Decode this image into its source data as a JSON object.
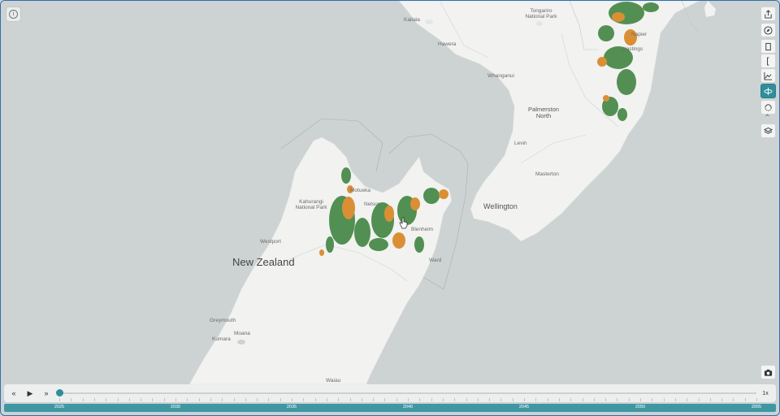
{
  "map": {
    "places": [
      {
        "id": "kaitaia",
        "name": "Kaitaia"
      },
      {
        "id": "tongariro",
        "name": "Tongariro National Park"
      },
      {
        "id": "hawera",
        "name": "Hawera"
      },
      {
        "id": "napier",
        "name": "Napier"
      },
      {
        "id": "hastings",
        "name": "Hastings"
      },
      {
        "id": "whanganui",
        "name": "Whanganui"
      },
      {
        "id": "palmerston",
        "name": "Palmerston North"
      },
      {
        "id": "levin",
        "name": "Levin"
      },
      {
        "id": "masterton",
        "name": "Masterton"
      },
      {
        "id": "wellington",
        "name": "Wellington"
      },
      {
        "id": "nelson",
        "name": "Nelson"
      },
      {
        "id": "motueka",
        "name": "Motueka"
      },
      {
        "id": "kahurangi",
        "name": "Kahurangi National Park"
      },
      {
        "id": "blenheim",
        "name": "Blenheim"
      },
      {
        "id": "ward",
        "name": "Ward"
      },
      {
        "id": "westport",
        "name": "Westport"
      },
      {
        "id": "newzealand",
        "name": "New Zealand"
      },
      {
        "id": "greymouth",
        "name": "Greymouth"
      },
      {
        "id": "moana",
        "name": "Moana"
      },
      {
        "id": "kumara",
        "name": "Kumara"
      },
      {
        "id": "waiau",
        "name": "Waiau"
      }
    ]
  },
  "controls": {
    "info_icon": "info-icon",
    "tools": [
      "share-icon",
      "compass-icon",
      "bookmark-icon",
      "bracket-icon",
      "chart-icon",
      "view-3d-icon",
      "rotate-icon",
      "collapse-icon",
      "layers-icon"
    ],
    "camera_icon": "camera-icon"
  },
  "timeline": {
    "rewind_label": "«",
    "play_label": "▶",
    "forward_label": "»",
    "speed": "1x",
    "years": [
      "2025",
      "2030",
      "2035",
      "2040",
      "2045",
      "2050",
      "2055"
    ],
    "progress": 0.0
  },
  "colors": {
    "accent": "#2f8e9a",
    "forest": "#4a8a4a",
    "orange": "#d98a2b",
    "water": "#cdd3d2",
    "land": "#f2f2f1"
  }
}
